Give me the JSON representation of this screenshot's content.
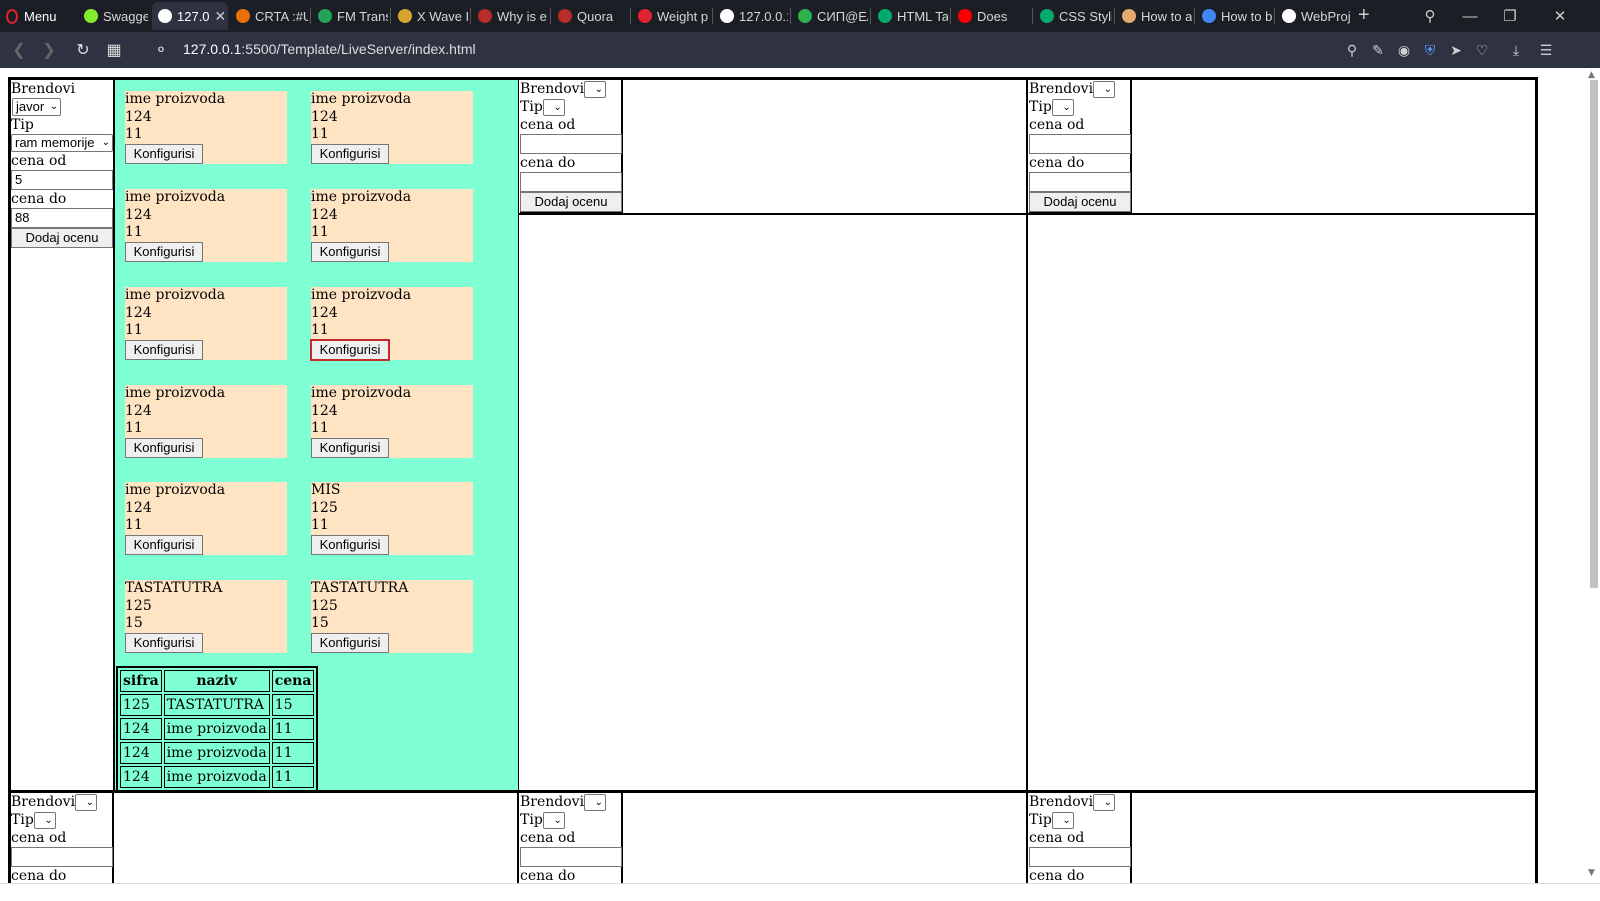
{
  "browser": {
    "menu_label": "Menu",
    "tabs": [
      {
        "label": "Swagger",
        "color": "#85ea2d"
      },
      {
        "label": "127.0",
        "color": "#ffffff",
        "active": true
      },
      {
        "label": "CRTA :#U",
        "color": "#e8710a"
      },
      {
        "label": "FM Trans",
        "color": "#23a455"
      },
      {
        "label": "X Wave F",
        "color": "#d4a72c"
      },
      {
        "label": "Why is e",
        "color": "#b92b27"
      },
      {
        "label": "Quora",
        "color": "#b92b27"
      },
      {
        "label": "Weight p",
        "color": "#e0242f"
      },
      {
        "label": "127.0.0.1",
        "color": "#ffffff"
      },
      {
        "label": "СИП@E/",
        "color": "#2bb24c"
      },
      {
        "label": "HTML Ta",
        "color": "#04aa6d"
      },
      {
        "label": "Does",
        "color": "#ff0000"
      },
      {
        "label": "CSS Styli",
        "color": "#04aa6d"
      },
      {
        "label": "How to a",
        "color": "#e6a96b"
      },
      {
        "label": "How to b",
        "color": "#4285f4"
      },
      {
        "label": "WebProj",
        "color": "#ffffff"
      }
    ],
    "url_host": "127.0.0.1",
    "url_rest": ":5500/Template/LiveServer/index.html"
  },
  "filter_full": {
    "brands_label": "Brendovi",
    "brand_value": "javor",
    "type_label": "Tip",
    "type_value": "ram memorije",
    "price_from_label": "cena od",
    "price_from_value": "5",
    "price_to_label": "cena do",
    "price_to_value": "88",
    "submit_label": "Dodaj ocenu"
  },
  "filter_empty": {
    "brands_label": "Brendovi",
    "type_label": "Tip",
    "price_from_label": "cena od",
    "price_to_label": "cena do",
    "submit_label": "Dodaj ocenu"
  },
  "products": [
    {
      "name": "ime proizvoda",
      "code": "124",
      "price": "11",
      "button": "Konfigurisi"
    },
    {
      "name": "ime proizvoda",
      "code": "124",
      "price": "11",
      "button": "Konfigurisi"
    },
    {
      "name": "ime proizvoda",
      "code": "124",
      "price": "11",
      "button": "Konfigurisi"
    },
    {
      "name": "ime proizvoda",
      "code": "124",
      "price": "11",
      "button": "Konfigurisi"
    },
    {
      "name": "ime proizvoda",
      "code": "124",
      "price": "11",
      "button": "Konfigurisi"
    },
    {
      "name": "ime proizvoda",
      "code": "124",
      "price": "11",
      "button": "Konfigurisi",
      "focused": true
    },
    {
      "name": "ime proizvoda",
      "code": "124",
      "price": "11",
      "button": "Konfigurisi"
    },
    {
      "name": "ime proizvoda",
      "code": "124",
      "price": "11",
      "button": "Konfigurisi"
    },
    {
      "name": "ime proizvoda",
      "code": "124",
      "price": "11",
      "button": "Konfigurisi"
    },
    {
      "name": "MIS",
      "code": "125",
      "price": "11",
      "button": "Konfigurisi"
    },
    {
      "name": "TASTATUTRA",
      "code": "125",
      "price": "15",
      "button": "Konfigurisi"
    },
    {
      "name": "TASTATUTRA",
      "code": "125",
      "price": "15",
      "button": "Konfigurisi"
    }
  ],
  "table": {
    "headers": [
      "sifra",
      "naziv",
      "cena"
    ],
    "rows": [
      [
        "125",
        "TASTATUTRA",
        "15"
      ],
      [
        "124",
        "ime proizvoda",
        "11"
      ],
      [
        "124",
        "ime proizvoda",
        "11"
      ],
      [
        "124",
        "ime proizvoda",
        "11"
      ]
    ]
  },
  "colors": {
    "products_bg": "#7fffd4",
    "card_bg": "#ffe4c4",
    "focus_ring": "#c42b2b"
  }
}
